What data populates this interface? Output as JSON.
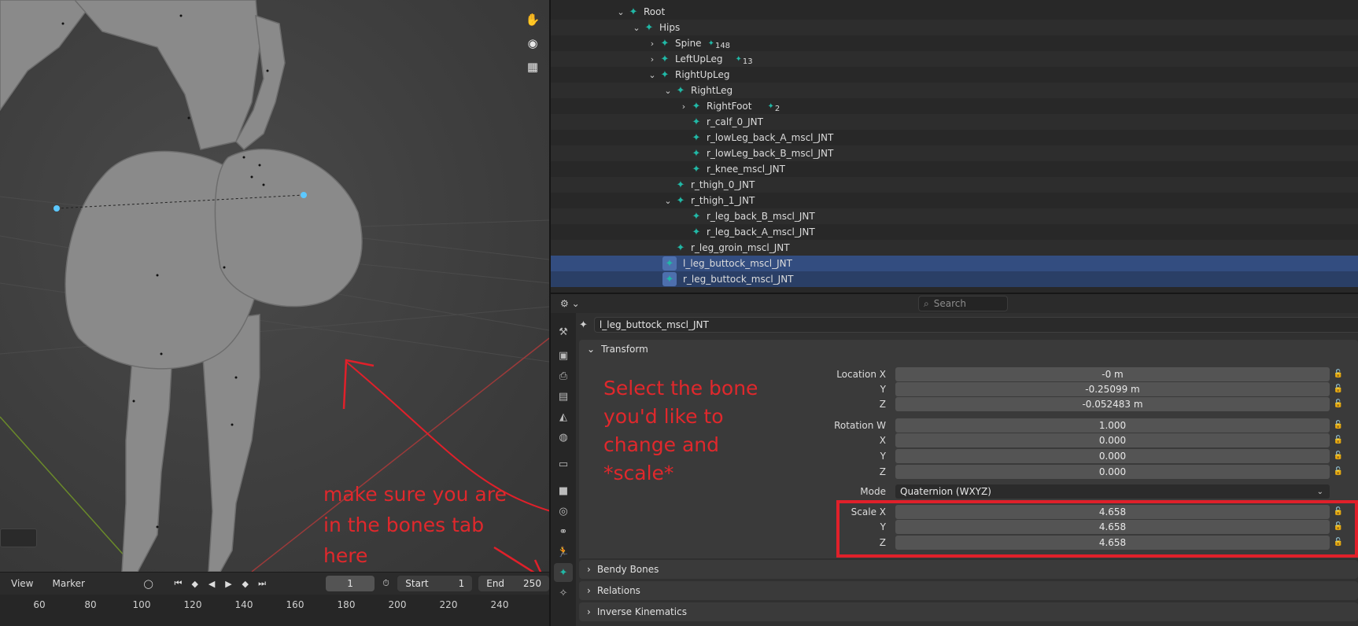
{
  "viewport": {
    "gizmo_icons": [
      "hand-icon",
      "camera-icon",
      "grid-icon"
    ],
    "annotation_left": [
      "make sure you are",
      "in the bones tab",
      "here"
    ]
  },
  "timeline": {
    "menu_view": "View",
    "menu_marker": "Marker",
    "current_frame": "1",
    "start_label": "Start",
    "start_value": "1",
    "end_label": "End",
    "end_value": "250",
    "ticks": [
      "60",
      "80",
      "100",
      "120",
      "140",
      "160",
      "180",
      "200",
      "220",
      "240"
    ]
  },
  "outliner": {
    "rows": [
      {
        "label": "Root",
        "chevron": "down"
      },
      {
        "label": "Hips",
        "chevron": "down"
      },
      {
        "label": "Spine",
        "chevron": "right",
        "count": "148"
      },
      {
        "label": "LeftUpLeg",
        "chevron": "right",
        "count": "13"
      },
      {
        "label": "RightUpLeg",
        "chevron": "down"
      },
      {
        "label": "RightLeg",
        "chevron": "down"
      },
      {
        "label": "RightFoot",
        "chevron": "right",
        "count": "2"
      },
      {
        "label": "r_calf_0_JNT"
      },
      {
        "label": "r_lowLeg_back_A_mscl_JNT"
      },
      {
        "label": "r_lowLeg_back_B_mscl_JNT"
      },
      {
        "label": "r_knee_mscl_JNT"
      },
      {
        "label": "r_thigh_0_JNT"
      },
      {
        "label": "r_thigh_1_JNT",
        "chevron": "down"
      },
      {
        "label": "r_leg_back_B_mscl_JNT"
      },
      {
        "label": "r_leg_back_A_mscl_JNT"
      },
      {
        "label": "r_leg_groin_mscl_JNT"
      },
      {
        "label": "l_leg_buttock_mscl_JNT"
      },
      {
        "label": "r_leg_buttock_mscl_JNT"
      }
    ]
  },
  "properties": {
    "search_placeholder": "Search",
    "bone_name": "l_leg_buttock_mscl_JNT",
    "transform": {
      "title": "Transform",
      "location": [
        {
          "label": "Location X",
          "value": "-0 m"
        },
        {
          "label": "Y",
          "value": "-0.25099 m"
        },
        {
          "label": "Z",
          "value": "-0.052483 m"
        }
      ],
      "rotation": [
        {
          "label": "Rotation W",
          "value": "1.000"
        },
        {
          "label": "X",
          "value": "0.000"
        },
        {
          "label": "Y",
          "value": "0.000"
        },
        {
          "label": "Z",
          "value": "0.000"
        }
      ],
      "mode_label": "Mode",
      "mode_value": "Quaternion (WXYZ)",
      "scale": [
        {
          "label": "Scale X",
          "value": "4.658"
        },
        {
          "label": "Y",
          "value": "4.658"
        },
        {
          "label": "Z",
          "value": "4.658"
        }
      ]
    },
    "panels": [
      "Bendy Bones",
      "Relations",
      "Inverse Kinematics"
    ],
    "annotation_right": [
      "Select the bone",
      "you'd like to",
      "change and",
      "*scale*"
    ]
  },
  "colors": {
    "bone_teal": "#21b8a6",
    "selection_blue": "#334d80",
    "annotation_red": "#e0282c"
  }
}
